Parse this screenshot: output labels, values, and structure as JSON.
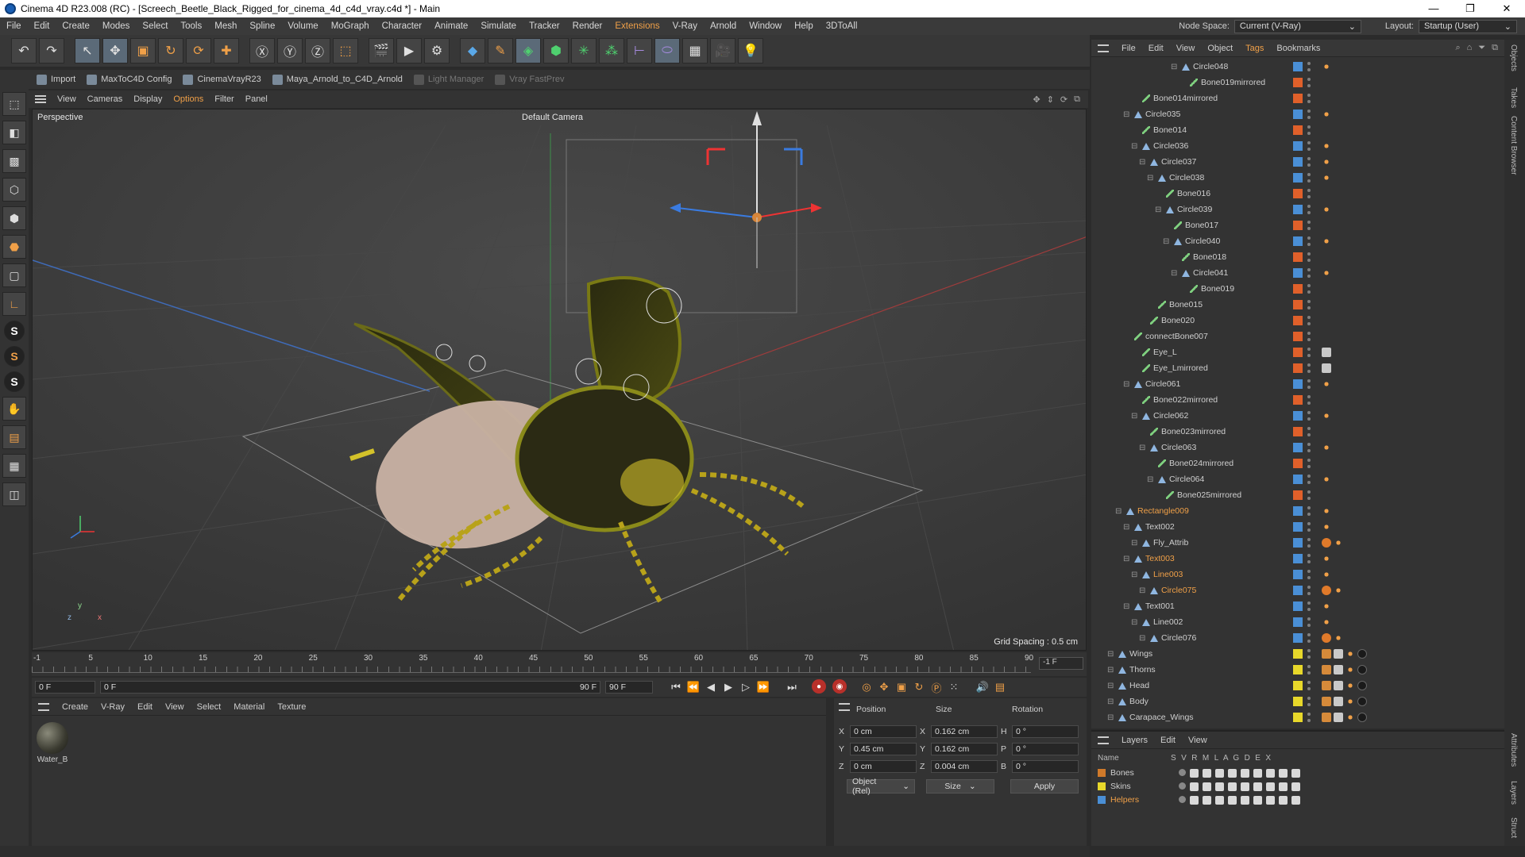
{
  "window": {
    "title": "Cinema 4D R23.008 (RC) - [Screech_Beetle_Black_Rigged_for_cinema_4d_c4d_vray.c4d *] - Main",
    "controls": [
      "—",
      "❐",
      "✕"
    ]
  },
  "menubar": {
    "items": [
      "File",
      "Edit",
      "Create",
      "Modes",
      "Select",
      "Tools",
      "Mesh",
      "Spline",
      "Volume",
      "MoGraph",
      "Character",
      "Animate",
      "Simulate",
      "Tracker",
      "Render",
      "Extensions",
      "V-Ray",
      "Arnold",
      "Window",
      "Help",
      "3DToAll"
    ],
    "node_space_label": "Node Space:",
    "node_space_value": "Current (V-Ray)",
    "layout_label": "Layout:",
    "layout_value": "Startup (User)"
  },
  "plugin_bar": {
    "items": [
      {
        "label": "Import",
        "dim": false
      },
      {
        "label": "MaxToC4D Config",
        "dim": false
      },
      {
        "label": "CinemaVrayR23",
        "dim": false
      },
      {
        "label": "Maya_Arnold_to_C4D_Arnold",
        "dim": false
      },
      {
        "label": "Light Manager",
        "dim": true
      },
      {
        "label": "Vray FastPrev",
        "dim": true
      }
    ]
  },
  "viewport": {
    "menu": [
      "View",
      "Cameras",
      "Display",
      "Options",
      "Filter",
      "Panel"
    ],
    "active_menu": "Options",
    "view_name": "Perspective",
    "camera_label": "Default Camera",
    "grid_spacing": "Grid Spacing : 0.5 cm",
    "axis_y": "y",
    "axis_z": "z",
    "axis_x": "x"
  },
  "timeline": {
    "ticks": [
      "-1",
      "5",
      "10",
      "15",
      "20",
      "25",
      "30",
      "35",
      "40",
      "45",
      "50",
      "55",
      "60",
      "65",
      "70",
      "75",
      "80",
      "85",
      "90"
    ],
    "current_frame_box": "-1 F"
  },
  "transport": {
    "start_frame": "0 F",
    "current_frame": "0 F",
    "end_frame_a": "90 F",
    "end_frame_b": "90 F"
  },
  "material_panel": {
    "menu": [
      "Create",
      "V-Ray",
      "Edit",
      "View",
      "Select",
      "Material",
      "Texture"
    ],
    "materials": [
      {
        "name": "Water_B"
      }
    ]
  },
  "attributes": {
    "headers": {
      "position": "Position",
      "size": "Size",
      "rotation": "Rotation"
    },
    "rows": [
      {
        "pos_axis": "X",
        "pos": "0 cm",
        "size_axis": "X",
        "size": "0.162 cm",
        "rot_axis": "H",
        "rot": "0 °"
      },
      {
        "pos_axis": "Y",
        "pos": "0.45 cm",
        "size_axis": "Y",
        "size": "0.162 cm",
        "rot_axis": "P",
        "rot": "0 °"
      },
      {
        "pos_axis": "Z",
        "pos": "0 cm",
        "size_axis": "Z",
        "size": "0.004 cm",
        "rot_axis": "B",
        "rot": "0 °"
      }
    ],
    "coord_mode": "Object (Rel)",
    "size_mode": "Size",
    "apply_label": "Apply"
  },
  "object_manager": {
    "menu": [
      "File",
      "Edit",
      "View",
      "Object",
      "Tags",
      "Bookmarks"
    ],
    "active_menu": "Tags",
    "objects": [
      {
        "name": "Circle048",
        "type": "null",
        "depth": 9,
        "color": "#4a8fd6",
        "tags": [
          "ik"
        ]
      },
      {
        "name": "Bone019mirrored",
        "type": "bone",
        "depth": 10,
        "color": "#e0602a",
        "tags": []
      },
      {
        "name": "Bone014mirrored",
        "type": "bone",
        "depth": 4,
        "color": "#e0602a",
        "tags": []
      },
      {
        "name": "Circle035",
        "type": "null",
        "depth": 3,
        "color": "#4a8fd6",
        "tags": [
          "ik"
        ]
      },
      {
        "name": "Bone014",
        "type": "bone",
        "depth": 4,
        "color": "#e0602a",
        "tags": []
      },
      {
        "name": "Circle036",
        "type": "null",
        "depth": 4,
        "color": "#4a8fd6",
        "tags": [
          "ik"
        ]
      },
      {
        "name": "Circle037",
        "type": "null",
        "depth": 5,
        "color": "#4a8fd6",
        "tags": [
          "ik"
        ]
      },
      {
        "name": "Circle038",
        "type": "null",
        "depth": 6,
        "color": "#4a8fd6",
        "tags": [
          "ik"
        ]
      },
      {
        "name": "Bone016",
        "type": "bone",
        "depth": 7,
        "color": "#e0602a",
        "tags": []
      },
      {
        "name": "Circle039",
        "type": "null",
        "depth": 7,
        "color": "#4a8fd6",
        "tags": [
          "ik"
        ]
      },
      {
        "name": "Bone017",
        "type": "bone",
        "depth": 8,
        "color": "#e0602a",
        "tags": []
      },
      {
        "name": "Circle040",
        "type": "null",
        "depth": 8,
        "color": "#4a8fd6",
        "tags": [
          "ik"
        ]
      },
      {
        "name": "Bone018",
        "type": "bone",
        "depth": 9,
        "color": "#e0602a",
        "tags": []
      },
      {
        "name": "Circle041",
        "type": "null",
        "depth": 9,
        "color": "#4a8fd6",
        "tags": [
          "ik"
        ]
      },
      {
        "name": "Bone019",
        "type": "bone",
        "depth": 10,
        "color": "#e0602a",
        "tags": []
      },
      {
        "name": "Bone015",
        "type": "bone",
        "depth": 6,
        "color": "#e0602a",
        "tags": []
      },
      {
        "name": "Bone020",
        "type": "bone",
        "depth": 5,
        "color": "#e0602a",
        "tags": []
      },
      {
        "name": "connectBone007",
        "type": "bone",
        "depth": 3,
        "color": "#e0602a",
        "tags": []
      },
      {
        "name": "Eye_L",
        "type": "bone",
        "depth": 4,
        "color": "#e0602a",
        "tags": [
          "xp"
        ]
      },
      {
        "name": "Eye_Lmirrored",
        "type": "bone",
        "depth": 4,
        "color": "#e0602a",
        "tags": [
          "xp"
        ]
      },
      {
        "name": "Circle061",
        "type": "null",
        "depth": 3,
        "color": "#4a8fd6",
        "tags": [
          "ik"
        ]
      },
      {
        "name": "Bone022mirrored",
        "type": "bone",
        "depth": 4,
        "color": "#e0602a",
        "tags": []
      },
      {
        "name": "Circle062",
        "type": "null",
        "depth": 4,
        "color": "#4a8fd6",
        "tags": [
          "ik"
        ]
      },
      {
        "name": "Bone023mirrored",
        "type": "bone",
        "depth": 5,
        "color": "#e0602a",
        "tags": []
      },
      {
        "name": "Circle063",
        "type": "null",
        "depth": 5,
        "color": "#4a8fd6",
        "tags": [
          "ik"
        ]
      },
      {
        "name": "Bone024mirrored",
        "type": "bone",
        "depth": 6,
        "color": "#e0602a",
        "tags": []
      },
      {
        "name": "Circle064",
        "type": "null",
        "depth": 6,
        "color": "#4a8fd6",
        "tags": [
          "ik"
        ]
      },
      {
        "name": "Bone025mirrored",
        "type": "bone",
        "depth": 7,
        "color": "#e0602a",
        "tags": []
      },
      {
        "name": "Rectangle009",
        "type": "null",
        "depth": 2,
        "color": "#4a8fd6",
        "tags": [
          "ik"
        ],
        "accent": true
      },
      {
        "name": "Text002",
        "type": "null",
        "depth": 3,
        "color": "#4a8fd6",
        "tags": [
          "ik"
        ]
      },
      {
        "name": "Fly_Attrib",
        "type": "null",
        "depth": 4,
        "color": "#4a8fd6",
        "tags": [
          "no",
          "ik"
        ]
      },
      {
        "name": "Text003",
        "type": "null",
        "depth": 3,
        "color": "#4a8fd6",
        "tags": [
          "ik"
        ],
        "accent": true
      },
      {
        "name": "Line003",
        "type": "null",
        "depth": 4,
        "color": "#4a8fd6",
        "tags": [
          "ik"
        ],
        "accent": true
      },
      {
        "name": "Circle075",
        "type": "null",
        "depth": 5,
        "color": "#4a8fd6",
        "tags": [
          "no",
          "ik"
        ],
        "accent": true
      },
      {
        "name": "Text001",
        "type": "null",
        "depth": 3,
        "color": "#4a8fd6",
        "tags": [
          "ik"
        ]
      },
      {
        "name": "Line002",
        "type": "null",
        "depth": 4,
        "color": "#4a8fd6",
        "tags": [
          "ik"
        ]
      },
      {
        "name": "Circle076",
        "type": "null",
        "depth": 5,
        "color": "#4a8fd6",
        "tags": [
          "no",
          "ik"
        ]
      },
      {
        "name": "Wings",
        "type": "null",
        "depth": 1,
        "color": "#e8d82a",
        "tags": [
          "ph",
          "xp",
          "ik",
          "sp"
        ]
      },
      {
        "name": "Thorns",
        "type": "null",
        "depth": 1,
        "color": "#e8d82a",
        "tags": [
          "ph",
          "xp",
          "ik",
          "sp"
        ]
      },
      {
        "name": "Head",
        "type": "null",
        "depth": 1,
        "color": "#e8d82a",
        "tags": [
          "ph",
          "xp",
          "ik",
          "sp"
        ]
      },
      {
        "name": "Body",
        "type": "null",
        "depth": 1,
        "color": "#e8d82a",
        "tags": [
          "ph",
          "xp",
          "ik",
          "sp"
        ]
      },
      {
        "name": "Carapace_Wings",
        "type": "null",
        "depth": 1,
        "color": "#e8d82a",
        "tags": [
          "ph",
          "xp",
          "ik",
          "sp"
        ]
      }
    ]
  },
  "layers": {
    "menu": [
      "Layers",
      "Edit",
      "View"
    ],
    "header_name": "Name",
    "header_flags": "S  V  R  M  L  A  G  D  E  X",
    "items": [
      {
        "name": "Bones",
        "color": "#d07a2a",
        "accent": false
      },
      {
        "name": "Skins",
        "color": "#e8d82a",
        "accent": false
      },
      {
        "name": "Helpers",
        "color": "#4a8fd6",
        "accent": true
      }
    ]
  },
  "right_tabs": [
    "Objects",
    "Takes",
    "Content Browser",
    "Attributes",
    "Layers",
    "Struct"
  ]
}
